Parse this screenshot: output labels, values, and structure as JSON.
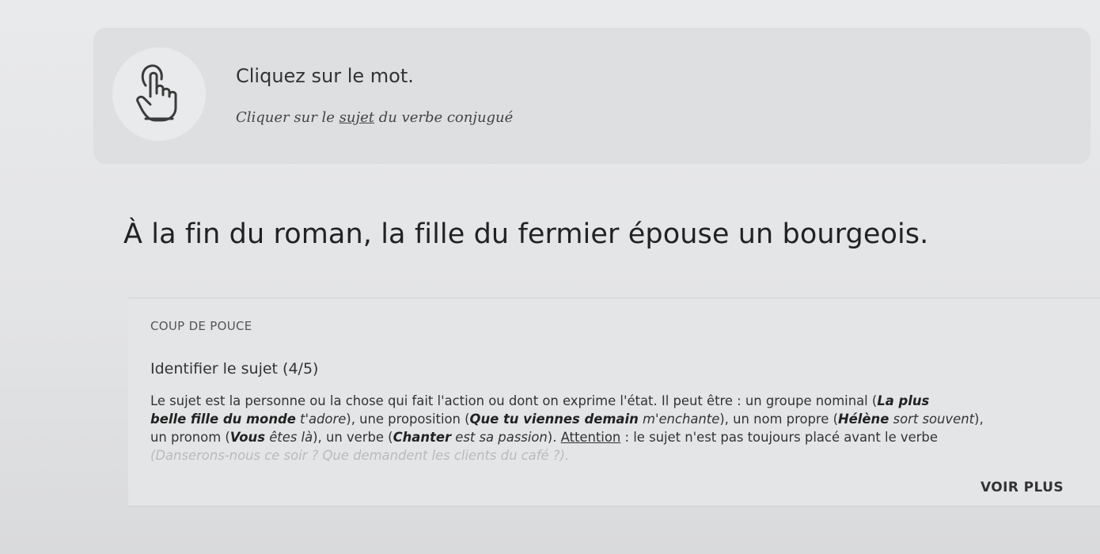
{
  "instruction": {
    "title": "Cliquez sur le mot.",
    "subtitle_before": "Cliquer sur le ",
    "subtitle_underlined": "sujet",
    "subtitle_after": " du verbe conjugué",
    "icon": "pointing-hand-icon"
  },
  "sentence": {
    "words": [
      "À",
      "la",
      "fin",
      "du",
      "roman,",
      "la",
      "fille",
      "du",
      "fermier",
      "épouse",
      "un",
      "bourgeois."
    ]
  },
  "hint": {
    "tag": "COUP DE POUCE",
    "title": "Identifier le sujet (4/5)",
    "line1_text": "Le sujet est la personne ou la chose qui fait l'action ou dont on exprime l'état. Il peut être : un groupe nominal (",
    "line1_bold": "La plus",
    "line2_bold1": "belle fille du monde",
    "line2_it1": " t'adore",
    "line2_text1": "), une proposition (",
    "line2_bold2": "Que tu viennes demain",
    "line2_it2": " m'enchante",
    "line2_text2": "), un nom propre (",
    "line2_bold3": "Hélène",
    "line2_it3": " sort souvent",
    "line2_text3": "),",
    "line3_text1": "un pronom (",
    "line3_bold1": "Vous",
    "line3_it1": " êtes là",
    "line3_text2": "), un verbe (",
    "line3_bold2": "Chanter",
    "line3_it2": " est sa passion",
    "line3_text3": "). ",
    "line3_underlined": "Attention",
    "line3_text4": " : le sujet n'est pas toujours placé avant le verbe",
    "line4_faded": "(Danserons-nous ce soir ? Que demandent les clients du café ?).",
    "see_more": "VOIR PLUS"
  }
}
